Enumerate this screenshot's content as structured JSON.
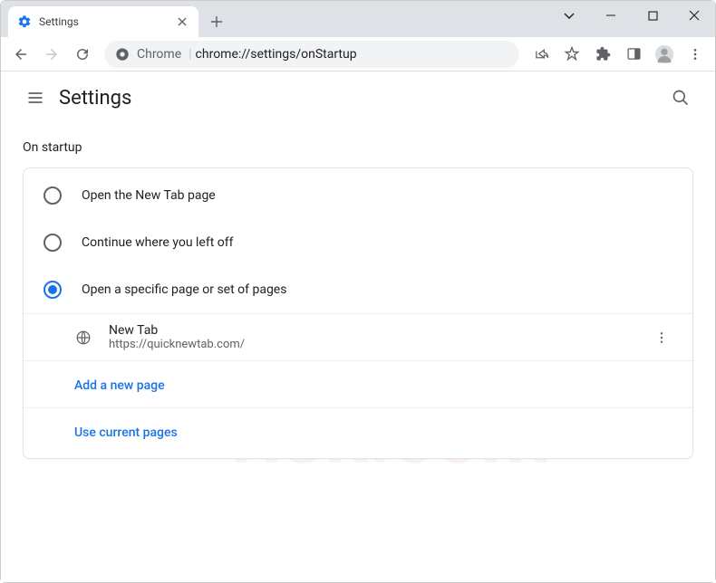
{
  "tab": {
    "title": "Settings"
  },
  "omnibox": {
    "origin": "Chrome",
    "path": "chrome://settings/onStartup"
  },
  "app": {
    "title": "Settings"
  },
  "section": {
    "title": "On startup",
    "options": [
      {
        "label": "Open the New Tab page",
        "selected": false
      },
      {
        "label": "Continue where you left off",
        "selected": false
      },
      {
        "label": "Open a specific page or set of pages",
        "selected": true
      }
    ],
    "pages": [
      {
        "title": "New Tab",
        "url": "https://quicknewtab.com/"
      }
    ],
    "add_label": "Add a new page",
    "use_current_label": "Use current pages"
  }
}
